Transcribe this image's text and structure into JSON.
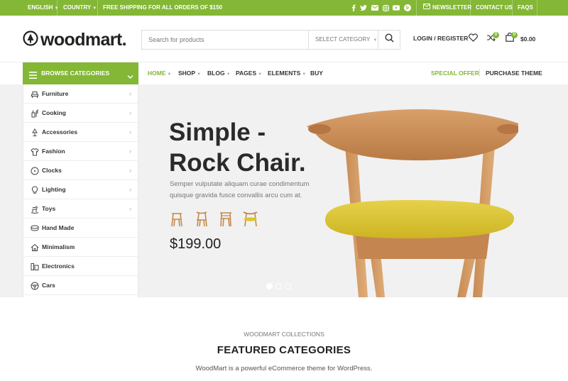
{
  "topbar": {
    "language": "ENGLISH",
    "country": "COUNTRY",
    "shipping": "FREE SHIPPING FOR ALL ORDERS OF $150",
    "social_icons": [
      "facebook-icon",
      "twitter-icon",
      "email-icon",
      "instagram-icon",
      "youtube-icon",
      "pinterest-icon"
    ],
    "newsletter": "NEWSLETTER",
    "contact": "CONTACT US",
    "faqs": "FAQS"
  },
  "header": {
    "logo": "woodmart.",
    "search_placeholder": "Search for products",
    "select_category": "SELECT CATEGORY",
    "login": "LOGIN / REGISTER",
    "compare_count": "0",
    "cart_count": "0",
    "cart_total": "$0.00"
  },
  "nav": {
    "browse": "BROWSE CATEGORIES",
    "items": [
      "HOME",
      "SHOP",
      "BLOG",
      "PAGES",
      "ELEMENTS",
      "BUY"
    ],
    "special_offer": "SPECIAL OFFER",
    "purchase_theme": "PURCHASE THEME"
  },
  "categories": [
    "Furniture",
    "Cooking",
    "Accessories",
    "Fashion",
    "Clocks",
    "Lighting",
    "Toys",
    "Hand Made",
    "Minimalism",
    "Electronics",
    "Cars"
  ],
  "hero": {
    "title_line1": "Simple -",
    "title_line2": "Rock Chair.",
    "description": "Semper vulputate aliquam curae condimentum quisque gravida fusce convallis arcu cum at.",
    "price": "$199.00",
    "slides_total": 3,
    "slide_active": 1
  },
  "featured": {
    "subtitle": "WOODMART COLLECTIONS",
    "title": "FEATURED CATEGORIES",
    "description": "WoodMart is a powerful eCommerce theme for WordPress."
  },
  "colors": {
    "accent": "#83b735",
    "hero_bg": "#f1f1f1"
  }
}
